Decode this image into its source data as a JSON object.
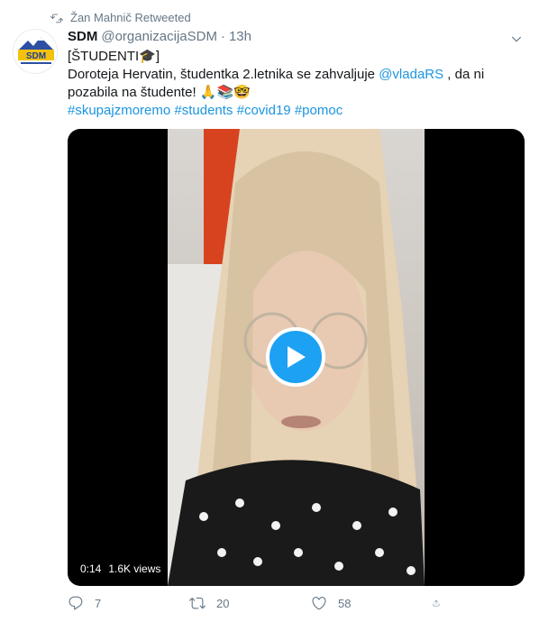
{
  "retweet": {
    "label": "Žan Mahnič Retweeted",
    "icon": "retweet-icon"
  },
  "author": {
    "name": "SDM",
    "handle": "@organizacijaSDM",
    "separator": "·",
    "time": "13h",
    "avatar_text": "SDM"
  },
  "tweet": {
    "line1": "[ŠTUDENTI🎓]",
    "line2_part1": "Doroteja Hervatin, študentka 2.letnika  se zahvaljuje ",
    "mention": "@vladaRS",
    "line2_part2": " , da ni pozabila na študente! 🙏📚🤓",
    "hashtags": [
      "#skupajzmoremo",
      "#students",
      "#covid19",
      "#pomoc"
    ]
  },
  "video": {
    "duration": "0:14",
    "views": "1.6K views"
  },
  "actions": {
    "replies": "7",
    "retweets": "20",
    "likes": "58"
  },
  "colors": {
    "link": "#1b95e0",
    "play": "#1da1f2",
    "muted": "#657786"
  }
}
